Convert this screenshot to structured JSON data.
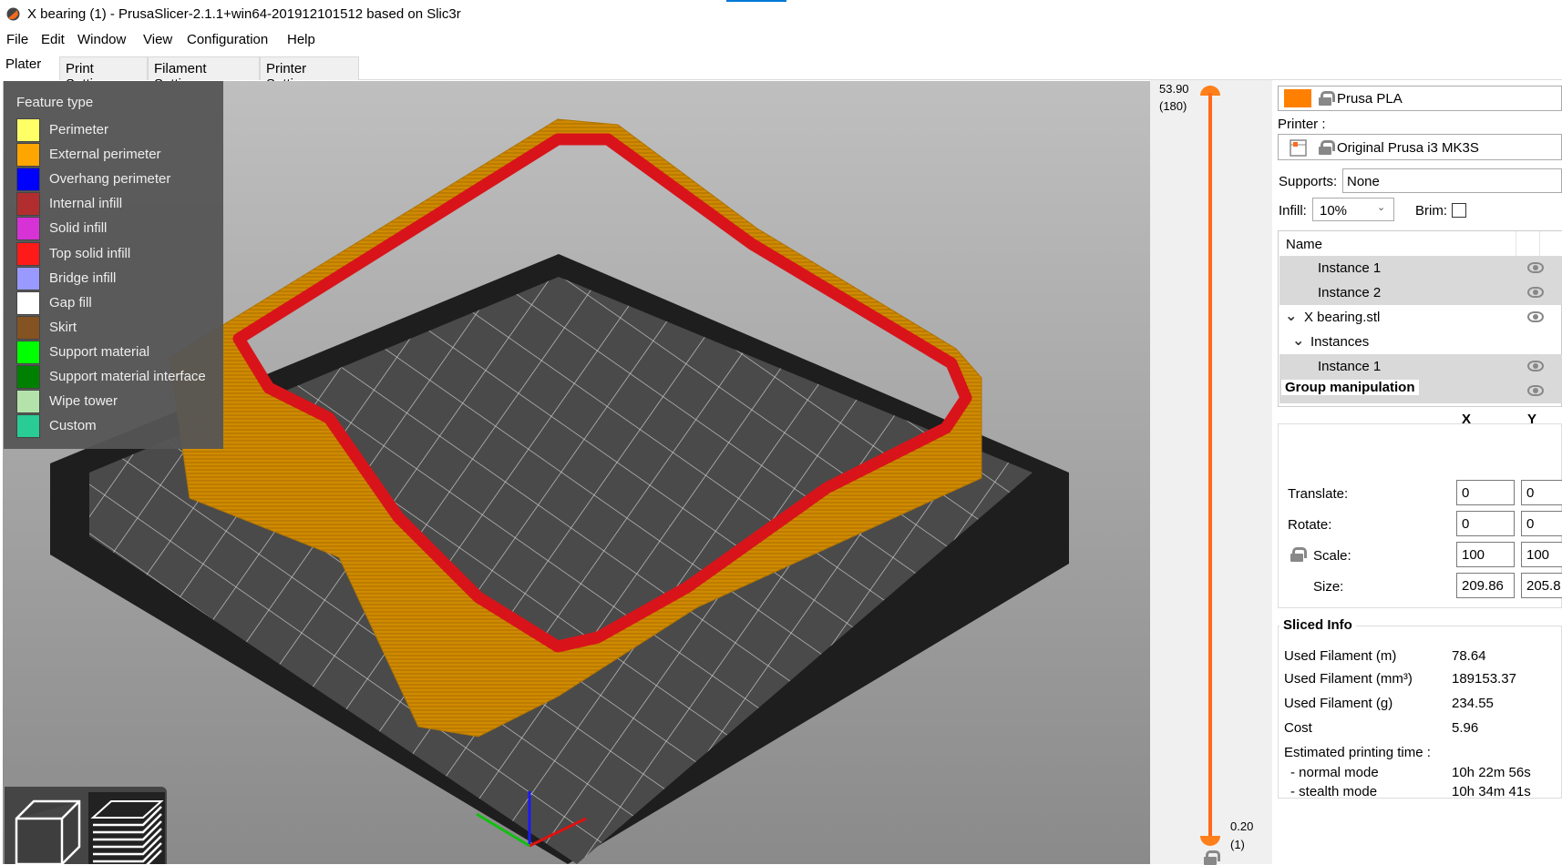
{
  "window": {
    "title": "X bearing (1) - PrusaSlicer-2.1.1+win64-201912101512 based on Slic3r",
    "app_icon": "prusaslicer-icon"
  },
  "menu": [
    "File",
    "Edit",
    "Window",
    "View",
    "Configuration",
    "Help"
  ],
  "tabs": [
    "Plater",
    "Print Settings",
    "Filament Settings",
    "Printer Settings"
  ],
  "legend": {
    "title": "Feature type",
    "items": [
      {
        "label": "Perimeter",
        "color": "#ffff66"
      },
      {
        "label": "External perimeter",
        "color": "#ffa500"
      },
      {
        "label": "Overhang perimeter",
        "color": "#0000ff"
      },
      {
        "label": "Internal infill",
        "color": "#b22e2e"
      },
      {
        "label": "Solid infill",
        "color": "#d632d6"
      },
      {
        "label": "Top solid infill",
        "color": "#ff1a1a"
      },
      {
        "label": "Bridge infill",
        "color": "#9999ff"
      },
      {
        "label": "Gap fill",
        "color": "#ffffff"
      },
      {
        "label": "Skirt",
        "color": "#845321"
      },
      {
        "label": "Support material",
        "color": "#00ff00"
      },
      {
        "label": "Support material interface",
        "color": "#008000"
      },
      {
        "label": "Wipe tower",
        "color": "#b3e3ab"
      },
      {
        "label": "Custom",
        "color": "#28cc94"
      }
    ]
  },
  "slider": {
    "top_value": "53.90",
    "top_layer": "(180)",
    "bottom_value": "0.20",
    "bottom_layer": "(1)",
    "color": "#ff7f1a"
  },
  "panel": {
    "filament": "Prusa PLA",
    "filament_color": "#ff8000",
    "printer_label": "Printer :",
    "printer": "Original Prusa i3 MK3S",
    "supports_label": "Supports:",
    "supports": "None",
    "infill_label": "Infill:",
    "infill": "10%",
    "brim_label": "Brim:",
    "brim_checked": false,
    "list": {
      "header": "Name",
      "rows": [
        {
          "label": "Instance 1",
          "level": 2,
          "selected": true,
          "eye": true
        },
        {
          "label": "Instance 2",
          "level": 2,
          "selected": true,
          "eye": true
        },
        {
          "label": "X bearing.stl",
          "level": 0,
          "selected": false,
          "eye": true,
          "expanded": true
        },
        {
          "label": "Instances",
          "level": 1,
          "selected": false,
          "eye": false,
          "expanded": true
        },
        {
          "label": "Instance 1",
          "level": 2,
          "selected": true,
          "eye": true
        },
        {
          "label": "Instance 2",
          "level": 2,
          "selected": true,
          "eye": true
        }
      ]
    },
    "manip": {
      "title": "Group manipulation",
      "x": "X",
      "y": "Y",
      "translate_label": "Translate:",
      "translate": [
        "0",
        "0"
      ],
      "rotate_label": "Rotate:",
      "rotate": [
        "0",
        "0"
      ],
      "scale_label": "Scale:",
      "scale": [
        "100",
        "100"
      ],
      "size_label": "Size:",
      "size": [
        "209.86",
        "205.8"
      ]
    },
    "sliced": {
      "title": "Sliced Info",
      "rows": [
        {
          "label": "Used Filament (m)",
          "value": "78.64"
        },
        {
          "label": "Used Filament (mm³)",
          "value": "189153.37"
        },
        {
          "label": "Used Filament (g)",
          "value": "234.55"
        },
        {
          "label": "Cost",
          "value": "5.96"
        },
        {
          "label": "Estimated printing time :",
          "value": ""
        },
        {
          "label": "- normal mode",
          "value": "10h 22m 56s"
        },
        {
          "label": "- stealth mode",
          "value": "10h 34m 41s"
        }
      ]
    }
  }
}
